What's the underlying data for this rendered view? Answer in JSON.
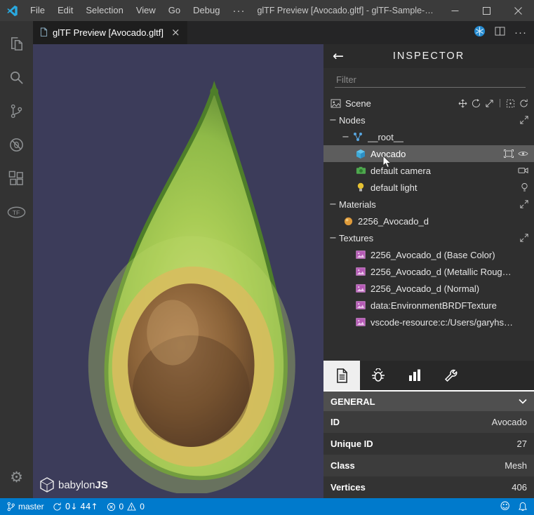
{
  "titlebar": {
    "menus": [
      "File",
      "Edit",
      "Selection",
      "View",
      "Go",
      "Debug",
      "···"
    ],
    "title": "glTF Preview [Avocado.gltf] - glTF-Sample-Models …"
  },
  "tabbar": {
    "tab_label": "glTF Preview [Avocado.gltf]"
  },
  "canvas": {
    "logo_left": "babylon",
    "logo_right": "JS"
  },
  "inspector": {
    "back": "←",
    "title": "INSPECTOR",
    "filter_placeholder": "Filter",
    "tree": [
      {
        "label": "Scene"
      },
      {
        "label": "Nodes"
      },
      {
        "label": "__root__"
      },
      {
        "label": "Avocado",
        "selected": true
      },
      {
        "label": "default camera"
      },
      {
        "label": "default light"
      },
      {
        "label": "Materials"
      },
      {
        "label": "2256_Avocado_d"
      },
      {
        "label": "Textures"
      },
      {
        "label": "2256_Avocado_d (Base Color)"
      },
      {
        "label": "2256_Avocado_d (Metallic Roug…"
      },
      {
        "label": "2256_Avocado_d (Normal)"
      },
      {
        "label": "data:EnvironmentBRDFTexture"
      },
      {
        "label": "vscode-resource:c:/Users/garyhs…"
      }
    ],
    "properties": {
      "section": "GENERAL",
      "rows": [
        {
          "label": "ID",
          "value": "Avocado"
        },
        {
          "label": "Unique ID",
          "value": "27"
        },
        {
          "label": "Class",
          "value": "Mesh"
        },
        {
          "label": "Vertices",
          "value": "406"
        }
      ]
    }
  },
  "statusbar": {
    "branch": "master",
    "sync": "0↓ 44↑",
    "errors": "0",
    "warnings": "0"
  },
  "icons": {
    "minus": "−",
    "close": "×",
    "more": "···",
    "gear": "⚙",
    "smiley": "☺",
    "gltf": "TF"
  },
  "colors": {
    "accent": "#007acc",
    "titlebar_bg": "#3b3b3b",
    "activitybar_bg": "#333333",
    "canvas_bg": "#3c3c5a",
    "inspector_bg": "#2f2f2f",
    "selection_bg": "#5d5d5d",
    "panel_header_bg": "#4f4f4f"
  }
}
